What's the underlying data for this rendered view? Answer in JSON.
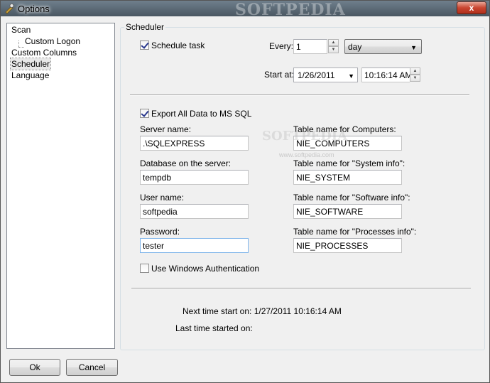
{
  "window": {
    "title": "Options",
    "watermark": "SOFTPEDIA",
    "close_label": "x"
  },
  "tree": {
    "items": [
      {
        "label": "Scan",
        "selected": false
      },
      {
        "label": "Custom Logon",
        "selected": false
      },
      {
        "label": "Custom Columns",
        "selected": false
      },
      {
        "label": "Scheduler",
        "selected": true
      },
      {
        "label": "Language",
        "selected": false
      }
    ]
  },
  "scheduler": {
    "group_title": "Scheduler",
    "schedule_task": {
      "label": "Schedule task",
      "checked": true
    },
    "every": {
      "label": "Every:",
      "value": "1",
      "unit": "day"
    },
    "start_at": {
      "label": "Start at:",
      "date": "1/26/2011",
      "time": "10:16:14 AM"
    },
    "export": {
      "label": "Export All Data to MS SQL",
      "checked": true
    },
    "server_name": {
      "label": "Server name:",
      "value": ".\\SQLEXPRESS"
    },
    "database": {
      "label": "Database on the server:",
      "value": "tempdb"
    },
    "user_name": {
      "label": "User name:",
      "value": "softpedia"
    },
    "password": {
      "label": "Password:",
      "value": "tester"
    },
    "windows_auth": {
      "label": "Use Windows Authentication",
      "checked": false
    },
    "table_computers": {
      "label": "Table name for Computers:",
      "value": "NIE_COMPUTERS"
    },
    "table_system": {
      "label": "Table name for \"System info\":",
      "value": "NIE_SYSTEM"
    },
    "table_software": {
      "label": "Table name for \"Software info\":",
      "value": "NIE_SOFTWARE"
    },
    "table_processes": {
      "label": "Table name for \"Processes info\":",
      "value": "NIE_PROCESSES"
    },
    "next_time": "Next time start on: 1/27/2011 10:16:14 AM",
    "last_time": "Last time started on:",
    "center_watermark": "SOFTPEDIA",
    "center_watermark_sub": "www.softpedia.com"
  },
  "buttons": {
    "ok": "Ok",
    "cancel": "Cancel"
  },
  "colors": {
    "titlebar": "#4a5762",
    "close": "#c94530",
    "checkmark": "#27368c",
    "focus_border": "#7eb4ea"
  }
}
